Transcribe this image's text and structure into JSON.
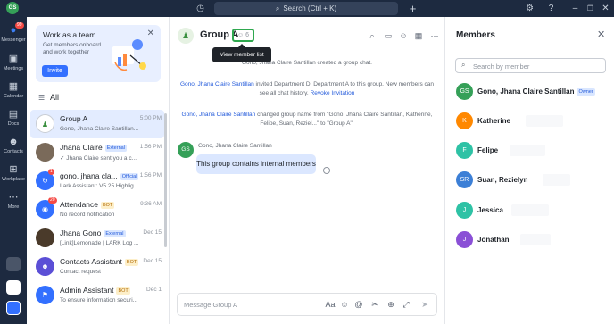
{
  "topbar": {
    "avatar_initials": "GS",
    "search_label": "Search (Ctrl + K)",
    "history_icon": "history-icon",
    "add_icon": "plus-icon"
  },
  "rail": {
    "items": [
      {
        "label": "Messenger",
        "icon": "chat-bubble-icon",
        "badge": "99"
      },
      {
        "label": "Meetings",
        "icon": "video-icon"
      },
      {
        "label": "Calendar",
        "icon": "calendar-icon"
      },
      {
        "label": "Docs",
        "icon": "docs-icon"
      },
      {
        "label": "Contacts",
        "icon": "contacts-icon"
      },
      {
        "label": "Workplace",
        "icon": "grid-icon"
      },
      {
        "label": "More",
        "icon": "more-icon"
      }
    ]
  },
  "promo": {
    "title": "Work as a team",
    "subtitle": "Get members onboard and work together",
    "button": "Invite"
  },
  "chatlist": {
    "filter_label": "All",
    "items": [
      {
        "name": "Group A",
        "time": "5:00 PM",
        "preview": "Gono, Jhana Claire Santillan...",
        "avatar": "GA",
        "color": "#ffffff"
      },
      {
        "name": "Jhana Claire",
        "tag": "External",
        "time": "1:56 PM",
        "preview": "✓ Jhana Claire sent you a c...",
        "avatar": "JC",
        "color": "#7a6a5a"
      },
      {
        "name": "gono, jhana cla...",
        "tag": "Official",
        "time": "1:56 PM",
        "preview": "Lark Assistant: V5.25 Highlig...",
        "avatar": "LA",
        "color": "#3370ff",
        "badge": "1"
      },
      {
        "name": "Attendance",
        "tag": "BOT",
        "time": "9:36 AM",
        "preview": "No record notification",
        "avatar": "AT",
        "color": "#3370ff",
        "badge": "20"
      },
      {
        "name": "Jhana Gono",
        "tag": "External",
        "time": "Dec 15",
        "preview": "[Link]Lemonade | LARK Log ...",
        "avatar": "JG",
        "color": "#4a3a2a"
      },
      {
        "name": "Contacts Assistant",
        "tag": "BOT",
        "time": "Dec 15",
        "preview": "Contact request",
        "avatar": "CA",
        "color": "#5b4fd6"
      },
      {
        "name": "Admin Assistant",
        "tag": "BOT",
        "time": "Dec 1",
        "preview": "To ensure information securi...",
        "avatar": "AA",
        "color": "#3370ff"
      }
    ]
  },
  "chat": {
    "title": "Group A",
    "member_count": "6",
    "tooltip": "View member list",
    "messages": {
      "created": "Gono, Jhana Claire Santillan created a group chat.",
      "invited_name": "Gono, Jhana Claire Santillan",
      "invited_text": " invited Department D, Department A to this group. New members can see all chat history. ",
      "revoke": "Revoke Invitation",
      "renamed_name": "Gono, Jhana Claire Santillan",
      "renamed_text": " changed group name from \"Gono, Jhana Claire Santillan, Katherine, Felipe, Suan, Reziel...\" to \"Group A\"."
    },
    "sender": "Gono, Jhana Claire Santillan",
    "sender_initials": "GS",
    "bubble": "This group contains internal members",
    "composer_placeholder": "Message Group A"
  },
  "members": {
    "title": "Members",
    "search_placeholder": "Search by member",
    "list": [
      {
        "name": "Gono, Jhana Claire Santillan",
        "initials": "GS",
        "color": "#35a058",
        "owner": "Owner"
      },
      {
        "name": "Katherine",
        "initials": "K",
        "color": "#ff8800"
      },
      {
        "name": "Felipe",
        "initials": "F",
        "color": "#2ec2a5"
      },
      {
        "name": "Suan, Rezielyn",
        "initials": "SR",
        "color": "#3c7fd6"
      },
      {
        "name": "Jessica",
        "initials": "J",
        "color": "#2ec2a5"
      },
      {
        "name": "Jonathan",
        "initials": "J",
        "color": "#8a4fd6"
      }
    ]
  },
  "colors": {
    "accent": "#3370ff",
    "highlight_border": "#2fa84f",
    "sidebar_bg": "#1d2a40"
  }
}
